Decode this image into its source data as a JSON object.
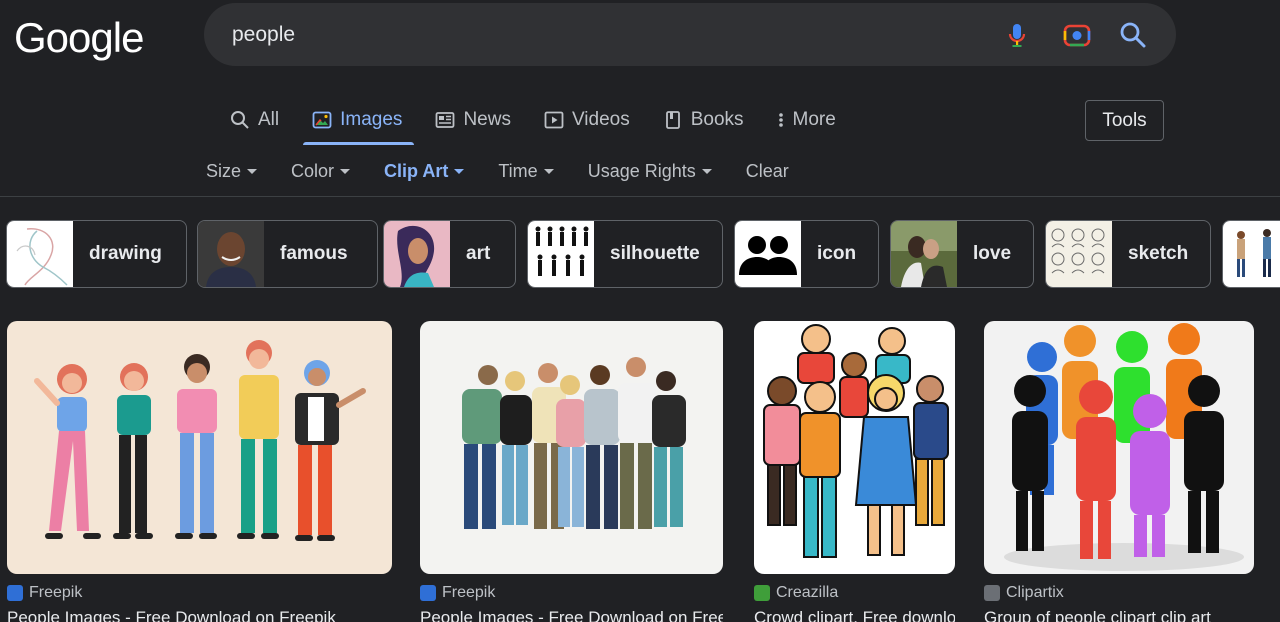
{
  "logo": "Google",
  "search": {
    "query": "people"
  },
  "tabs": [
    {
      "label": "All",
      "icon": "search-icon"
    },
    {
      "label": "Images",
      "icon": "image-icon",
      "active": true
    },
    {
      "label": "News",
      "icon": "news-icon"
    },
    {
      "label": "Videos",
      "icon": "video-icon"
    },
    {
      "label": "Books",
      "icon": "book-icon"
    },
    {
      "label": "More",
      "icon": "more-vert-icon"
    }
  ],
  "tools_label": "Tools",
  "filters": [
    {
      "label": "Size",
      "dropdown": true
    },
    {
      "label": "Color",
      "dropdown": true
    },
    {
      "label": "Clip Art",
      "dropdown": true,
      "active": true
    },
    {
      "label": "Time",
      "dropdown": true
    },
    {
      "label": "Usage Rights",
      "dropdown": true
    },
    {
      "label": "Clear",
      "dropdown": false
    }
  ],
  "chips": [
    {
      "label": "drawing"
    },
    {
      "label": "famous"
    },
    {
      "label": "art"
    },
    {
      "label": "silhouette"
    },
    {
      "label": "icon"
    },
    {
      "label": "love"
    },
    {
      "label": "sketch"
    },
    {
      "label": ""
    }
  ],
  "results": [
    {
      "source": "Freepik",
      "title": "People Images - Free Download on Freepik",
      "favicon_color": "#2f6fd6"
    },
    {
      "source": "Freepik",
      "title": "People Images - Free Download on Freepik",
      "favicon_color": "#2f6fd6"
    },
    {
      "source": "Creazilla",
      "title": "Crowd clipart. Free download",
      "favicon_color": "#3f9e3a"
    },
    {
      "source": "Clipartix",
      "title": "Group of people clipart clip art",
      "favicon_color": "#6b6f75"
    }
  ],
  "colors": {
    "accent": "#8ab4f8",
    "background": "#202124",
    "search_bg": "#303134"
  }
}
